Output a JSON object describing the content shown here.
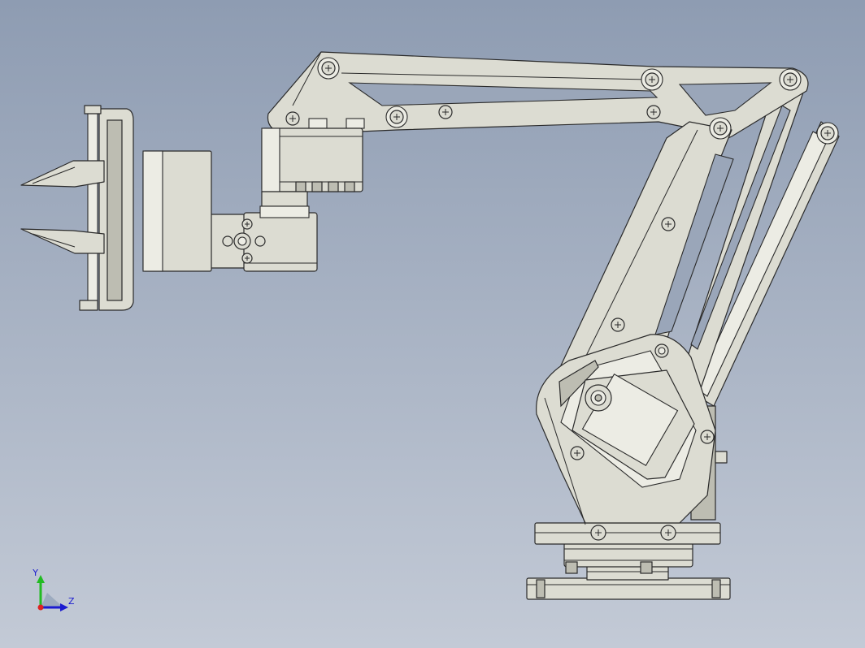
{
  "view": {
    "background_top": "#8e9cb2",
    "background_bottom": "#c3cad6",
    "part_color": "#dcdcd2"
  },
  "axis_triad": {
    "y_label": "Y",
    "z_label": "Z",
    "y_color": "#22bb22",
    "z_color": "#1b1bd0",
    "x_color": "#dd2222"
  }
}
